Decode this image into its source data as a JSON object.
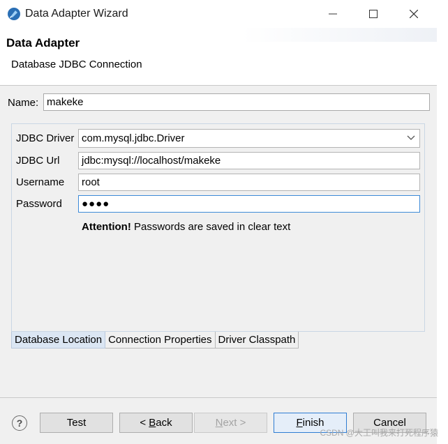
{
  "window": {
    "title": "Data Adapter Wizard"
  },
  "header": {
    "title": "Data Adapter",
    "subtitle": "Database JDBC Connection"
  },
  "name": {
    "label": "Name:",
    "value": "makeke"
  },
  "fields": {
    "driver": {
      "label": "JDBC Driver",
      "value": "com.mysql.jdbc.Driver"
    },
    "url": {
      "label": "JDBC Url",
      "value": "jdbc:mysql://localhost/makeke"
    },
    "username": {
      "label": "Username",
      "value": "root"
    },
    "password": {
      "label": "Password",
      "value": "●●●●"
    }
  },
  "attention": {
    "bold": "Attention!",
    "text": " Passwords are saved in clear text"
  },
  "tabs": [
    {
      "label": "Database Location",
      "active": true
    },
    {
      "label": "Connection Properties",
      "active": false
    },
    {
      "label": "Driver Classpath",
      "active": false
    }
  ],
  "footer": {
    "help": "?",
    "test": "Test",
    "back_prefix": "< ",
    "back_mnemonic": "B",
    "back_rest": "ack",
    "next_mnemonic": "N",
    "next_rest": "ext >",
    "finish_mnemonic": "F",
    "finish_rest": "inish",
    "cancel": "Cancel"
  },
  "watermark": "CSDN @大王叫我来打死程序猿",
  "colors": {
    "accent": "#2f7dd3",
    "active_tab": "#dbe6f3",
    "dialog_bg": "#f0f0f0"
  }
}
